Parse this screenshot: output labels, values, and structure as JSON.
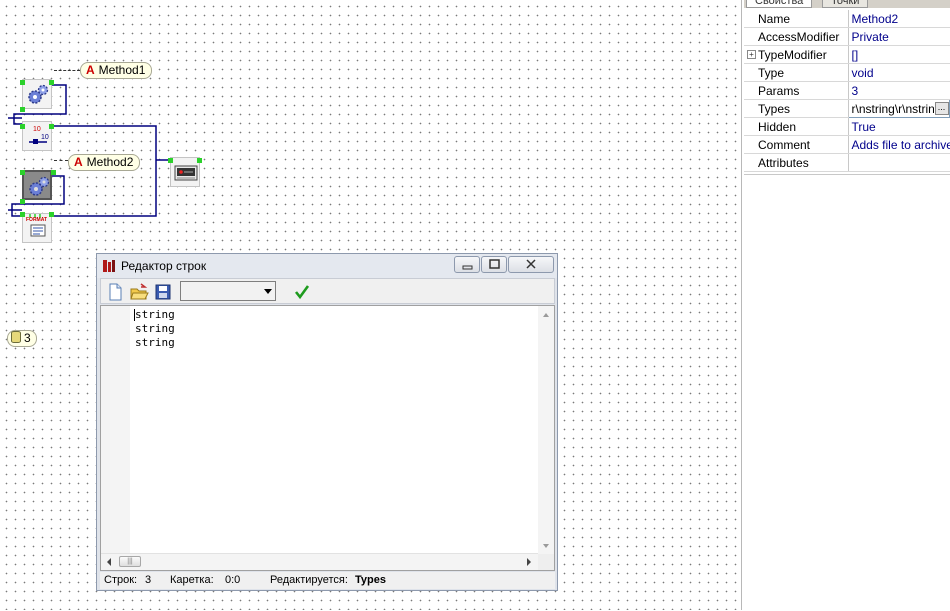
{
  "canvas": {
    "labels": {
      "method1": "Method1",
      "method2": "Method2",
      "a_glyph": "A"
    },
    "counter": "3",
    "icons": {
      "method1_component": "gears-icon",
      "method2_component": "gears-icon",
      "counter_component": "counter-10-icon",
      "format_component": "format-string-icon",
      "archive_component": "archive-icon",
      "counter_badge": "database-icon"
    },
    "format_text": "FORMAT",
    "counter_text": "10"
  },
  "props": {
    "tabs": [
      "Свойства",
      "Точки"
    ],
    "rows": [
      {
        "name": "Name",
        "value": "Method2"
      },
      {
        "name": "AccessModifier",
        "value": "Private"
      },
      {
        "name": "TypeModifier",
        "value": "[]",
        "expand": "+"
      },
      {
        "name": "Type",
        "value": "void"
      },
      {
        "name": "Params",
        "value": "3"
      },
      {
        "name": "Types",
        "value": "r\\nstring\\r\\nstring",
        "ellipsis": "..."
      },
      {
        "name": "Hidden",
        "value": "True"
      },
      {
        "name": "Comment",
        "value": "Adds file to archive"
      },
      {
        "name": "Attributes",
        "value": ""
      }
    ]
  },
  "editor": {
    "title": "Редактор строк",
    "lines": [
      "string",
      "string",
      "string"
    ],
    "window_buttons": {
      "minimize": "minimize-icon",
      "maximize": "maximize-icon",
      "close": "close-icon"
    },
    "toolbar": {
      "new": "new-file-icon",
      "open": "open-folder-icon",
      "save": "save-disk-icon",
      "apply": "checkmark-icon",
      "encoding_value": ""
    },
    "status": {
      "lines_label": "Строк:",
      "lines_value": "3",
      "caret_label": "Каретка:",
      "caret_value": "0:0",
      "editing_label": "Редактируется:",
      "editing_value": "Types"
    },
    "hthumb_grip": "|||"
  },
  "colors": {
    "pin": "#2bd12b",
    "wire": "#00007f",
    "label_bg": "#ffffe6",
    "value_text": "#00008b"
  }
}
